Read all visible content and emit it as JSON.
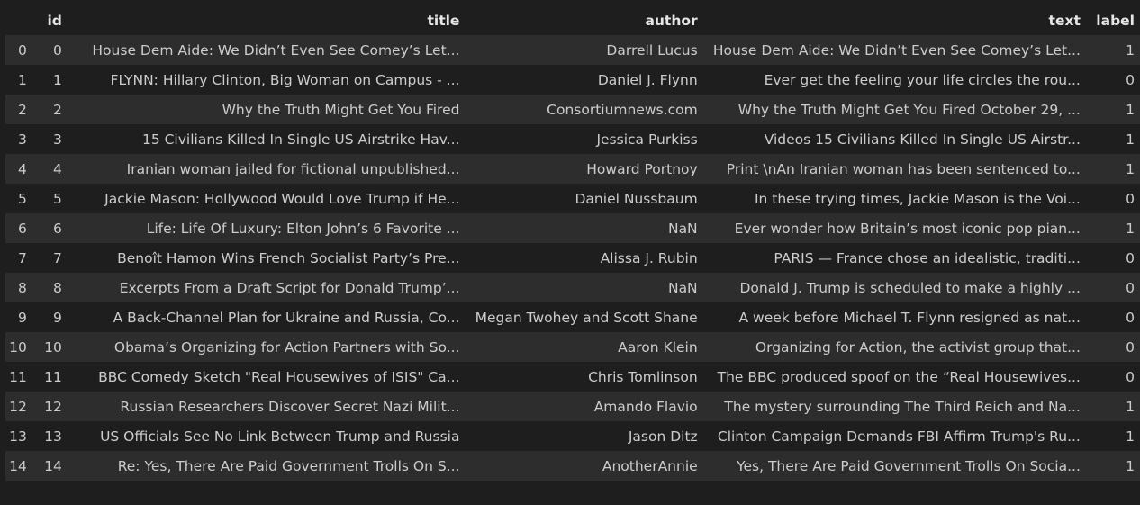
{
  "columns": [
    "",
    "id",
    "title",
    "author",
    "text",
    "label"
  ],
  "rows": [
    [
      "0",
      "0",
      "House Dem Aide: We Didn’t Even See Comey’s Let...",
      "Darrell Lucus",
      "House Dem Aide: We Didn’t Even See Comey’s Let...",
      "1"
    ],
    [
      "1",
      "1",
      "FLYNN: Hillary Clinton, Big Woman on Campus - ...",
      "Daniel J. Flynn",
      "Ever get the feeling your life circles the rou...",
      "0"
    ],
    [
      "2",
      "2",
      "Why the Truth Might Get You Fired",
      "Consortiumnews.com",
      "Why the Truth Might Get You Fired October 29, ...",
      "1"
    ],
    [
      "3",
      "3",
      "15 Civilians Killed In Single US Airstrike Hav...",
      "Jessica Purkiss",
      "Videos 15 Civilians Killed In Single US Airstr...",
      "1"
    ],
    [
      "4",
      "4",
      "Iranian woman jailed for fictional unpublished...",
      "Howard Portnoy",
      "Print \\nAn Iranian woman has been sentenced to...",
      "1"
    ],
    [
      "5",
      "5",
      "Jackie Mason: Hollywood Would Love Trump if He...",
      "Daniel Nussbaum",
      "In these trying times, Jackie Mason is the Voi...",
      "0"
    ],
    [
      "6",
      "6",
      "Life: Life Of Luxury: Elton John’s 6 Favorite ...",
      "NaN",
      "Ever wonder how Britain’s most iconic pop pian...",
      "1"
    ],
    [
      "7",
      "7",
      "Benoît Hamon Wins French Socialist Party’s Pre...",
      "Alissa J. Rubin",
      "PARIS — France chose an idealistic, traditi...",
      "0"
    ],
    [
      "8",
      "8",
      "Excerpts From a Draft Script for Donald Trump’...",
      "NaN",
      "Donald J. Trump is scheduled to make a highly ...",
      "0"
    ],
    [
      "9",
      "9",
      "A Back-Channel Plan for Ukraine and Russia, Co...",
      "Megan Twohey and Scott Shane",
      "A week before Michael T. Flynn resigned as nat...",
      "0"
    ],
    [
      "10",
      "10",
      "Obama’s Organizing for Action Partners with So...",
      "Aaron Klein",
      "Organizing for Action, the activist group that...",
      "0"
    ],
    [
      "11",
      "11",
      "BBC Comedy Sketch \"Real Housewives of ISIS\" Ca...",
      "Chris Tomlinson",
      "The BBC produced spoof on the “Real Housewives...",
      "0"
    ],
    [
      "12",
      "12",
      "Russian Researchers Discover Secret Nazi Milit...",
      "Amando Flavio",
      "The mystery surrounding The Third Reich and Na...",
      "1"
    ],
    [
      "13",
      "13",
      "US Officials See No Link Between Trump and Russia",
      "Jason Ditz",
      "Clinton Campaign Demands FBI Affirm Trump's Ru...",
      "1"
    ],
    [
      "14",
      "14",
      "Re: Yes, There Are Paid Government Trolls On S...",
      "AnotherAnnie",
      "Yes, There Are Paid Government Trolls On Socia...",
      "1"
    ]
  ]
}
